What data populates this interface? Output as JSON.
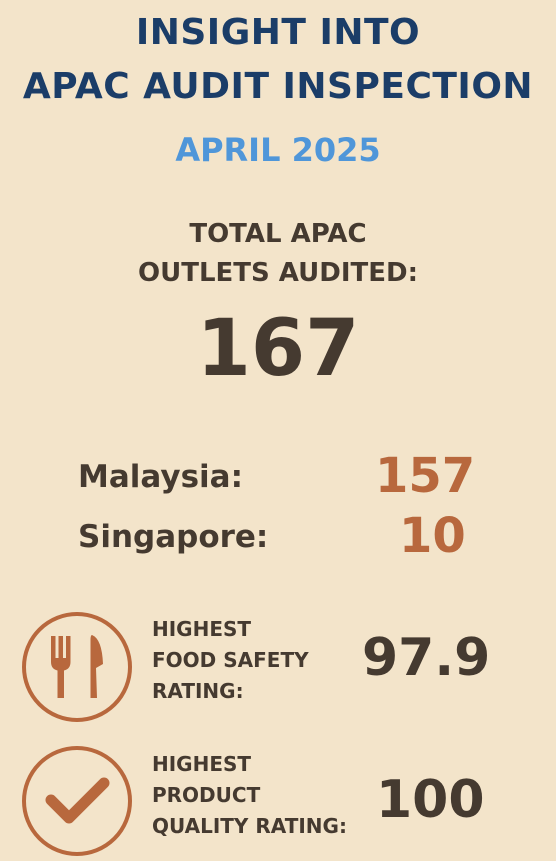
{
  "header": {
    "title_line1": "INSIGHT INTO",
    "title_line2": "APAC AUDIT INSPECTION",
    "period": "APRIL 2025"
  },
  "total": {
    "label_line1": "TOTAL APAC",
    "label_line2": "OUTLETS AUDITED:",
    "value": "167"
  },
  "countries": [
    {
      "label": "Malaysia:",
      "value": "157"
    },
    {
      "label": "Singapore:",
      "value": "10"
    }
  ],
  "ratings": [
    {
      "icon": "fork-knife-icon",
      "label_line1": "HIGHEST",
      "label_line2": "FOOD SAFETY",
      "label_line3": "RATING:",
      "value": "97.9"
    },
    {
      "icon": "checkmark-icon",
      "label_line1": "HIGHEST",
      "label_line2": "PRODUCT",
      "label_line3": "QUALITY RATING:",
      "value": "100"
    }
  ],
  "colors": {
    "background": "#f3e4ca",
    "title": "#1b3d68",
    "period": "#4f96d9",
    "text": "#453a30",
    "accent": "#b8683d"
  }
}
